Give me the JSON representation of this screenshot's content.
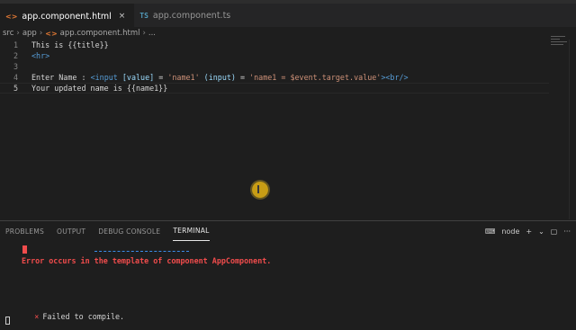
{
  "tabs": [
    {
      "icon": "<>",
      "label": "app.component.html",
      "close": "×"
    },
    {
      "icon": "TS",
      "label": "app.component.ts"
    }
  ],
  "breadcrumb": {
    "parts": [
      "src",
      "app"
    ],
    "icon": "<>",
    "file": "app.component.html",
    "tail": "..."
  },
  "editor": {
    "lines": [
      {
        "num": "1",
        "text": "This is {{title}}"
      },
      {
        "num": "2",
        "tag": "<hr>"
      },
      {
        "num": "3"
      },
      {
        "num": "4",
        "prefix": "Enter Name : ",
        "tag_open": "<input",
        "attr1": "[value]",
        "eq1": " = ",
        "str1": "'name1'",
        "attr2": "(input)",
        "eq2": " = ",
        "str2": "'name1 = $event.target.value'",
        "tag_close": "><br/>"
      },
      {
        "num": "5",
        "text": "Your updated name is {{name1}}"
      }
    ]
  },
  "panel": {
    "tabs": [
      "PROBLEMS",
      "OUTPUT",
      "DEBUG CONSOLE",
      "TERMINAL"
    ],
    "active_tab": "TERMINAL",
    "shell_label": "node",
    "add": "+",
    "dropdown": "⌄",
    "maximize": "▢",
    "more": "···"
  },
  "terminal": {
    "error_line": "Error occurs in the template of component AppComponent.",
    "fail_mark": "×",
    "fail_line": "Failed to compile."
  },
  "colors": {
    "error": "#f14c4c",
    "tag": "#569cd6",
    "attr": "#9cdcfe",
    "string": "#ce9178"
  }
}
